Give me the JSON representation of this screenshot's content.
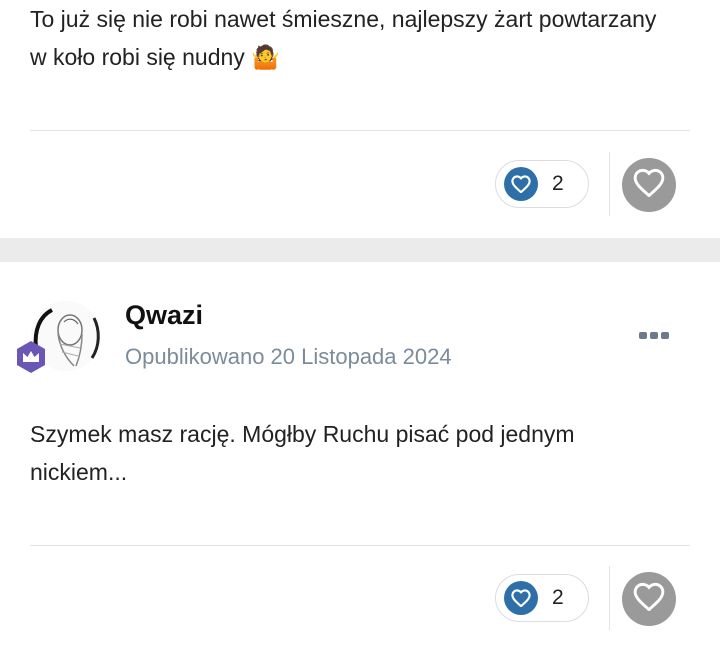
{
  "posts": [
    {
      "text": "To już się nie robi nawet śmieszne, najlepszy żart powtarzany w koło robi się nudny 🤷",
      "reaction_count": "2"
    },
    {
      "author": "Qwazi",
      "date": "Opublikowano 20 Listopada 2024",
      "text": "Szymek masz rację. Mógłby Ruchu pisać pod jednym nickiem...",
      "reaction_count": "2"
    }
  ],
  "icons": {
    "reaction": "heart-icon",
    "like": "heart-icon",
    "more": "more-options-icon",
    "rank": "crown-icon"
  },
  "colors": {
    "reaction_badge": "#2e6fa7",
    "like_button": "#9a9a9a",
    "date_text": "#7c8b9a",
    "rank_badge": "#6b56b5"
  }
}
